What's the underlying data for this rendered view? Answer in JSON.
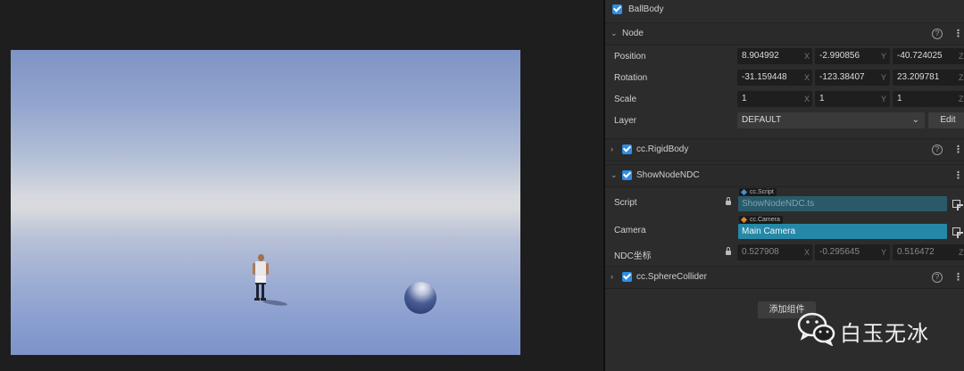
{
  "scene": {
    "objects": [
      "player-character",
      "sphere-ball"
    ]
  },
  "inspector": {
    "node_name": "BallBody",
    "node_section": {
      "title": "Node",
      "position": {
        "label": "Position",
        "x": "8.904992",
        "y": "-2.990856",
        "z": "-40.724025"
      },
      "rotation": {
        "label": "Rotation",
        "x": "-31.159448",
        "y": "-123.38407",
        "z": "23.209781"
      },
      "scale": {
        "label": "Scale",
        "x": "1",
        "y": "1",
        "z": "1"
      },
      "layer": {
        "label": "Layer",
        "value": "DEFAULT",
        "edit_label": "Edit"
      },
      "axis_labels": {
        "x": "X",
        "y": "Y",
        "z": "Z"
      }
    },
    "rigid_body": {
      "title": "cc.RigidBody"
    },
    "show_node_ndc": {
      "title": "ShowNodeNDC",
      "script": {
        "label": "Script",
        "tag": "cc.Script",
        "value": "ShowNodeNDC.ts"
      },
      "camera": {
        "label": "Camera",
        "tag": "cc.Camera",
        "value": "Main Camera"
      },
      "ndc": {
        "label": "NDC坐标",
        "x": "0.527908",
        "y": "-0.295645",
        "z": "0.516472"
      }
    },
    "sphere_collider": {
      "title": "cc.SphereCollider"
    },
    "add_component_label": "添加组件"
  },
  "watermark": {
    "text": "白玉无冰"
  },
  "colors": {
    "checkbox": "#2f8de4",
    "script_field": "#2a5a6a",
    "camera_field": "#2688a8"
  },
  "icons": [
    "checkbox-icon",
    "chevron-down-icon",
    "chevron-right-icon",
    "help-icon",
    "menu-dots-icon",
    "lock-icon",
    "locate-icon",
    "wechat-logo-icon"
  ]
}
